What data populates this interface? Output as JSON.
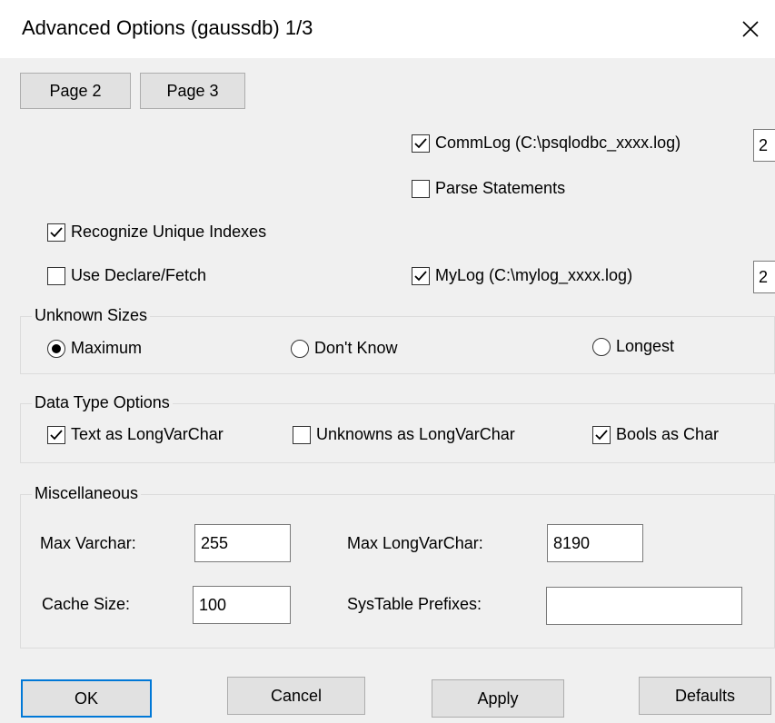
{
  "window": {
    "title": "Advanced Options (gaussdb) 1/3"
  },
  "page_buttons": {
    "page2": "Page 2",
    "page3": "Page 3"
  },
  "options": {
    "commlog": {
      "label": "CommLog (C:\\psqlodbc_xxxx.log)",
      "checked": true,
      "level": "2"
    },
    "parse_statements": {
      "label": "Parse Statements",
      "checked": false
    },
    "recognize_unique_indexes": {
      "label": "Recognize Unique Indexes",
      "checked": true
    },
    "use_declare_fetch": {
      "label": "Use Declare/Fetch",
      "checked": false
    },
    "mylog": {
      "label": "MyLog (C:\\mylog_xxxx.log)",
      "checked": true,
      "level": "2"
    }
  },
  "unknown_sizes": {
    "title": "Unknown Sizes",
    "options": [
      {
        "label": "Maximum",
        "selected": true
      },
      {
        "label": "Don't Know",
        "selected": false
      },
      {
        "label": "Longest",
        "selected": false
      }
    ]
  },
  "data_type_options": {
    "title": "Data Type Options",
    "options": [
      {
        "label": "Text as LongVarChar",
        "checked": true
      },
      {
        "label": "Unknowns as LongVarChar",
        "checked": false
      },
      {
        "label": "Bools as Char",
        "checked": true
      }
    ]
  },
  "miscellaneous": {
    "title": "Miscellaneous",
    "max_varchar": {
      "label": "Max Varchar:",
      "value": "255"
    },
    "max_longvarchar": {
      "label": "Max LongVarChar:",
      "value": "8190"
    },
    "cache_size": {
      "label": "Cache Size:",
      "value": "100"
    },
    "systable_prefixes": {
      "label": "SysTable Prefixes:",
      "value": ""
    }
  },
  "footer": {
    "ok": "OK",
    "cancel": "Cancel",
    "apply": "Apply",
    "defaults": "Defaults"
  },
  "colors": {
    "dialog_bg": "#f0f0f0",
    "title_bg": "#ffffff",
    "button_bg": "#e1e1e1",
    "focus_border": "#0078d7"
  }
}
